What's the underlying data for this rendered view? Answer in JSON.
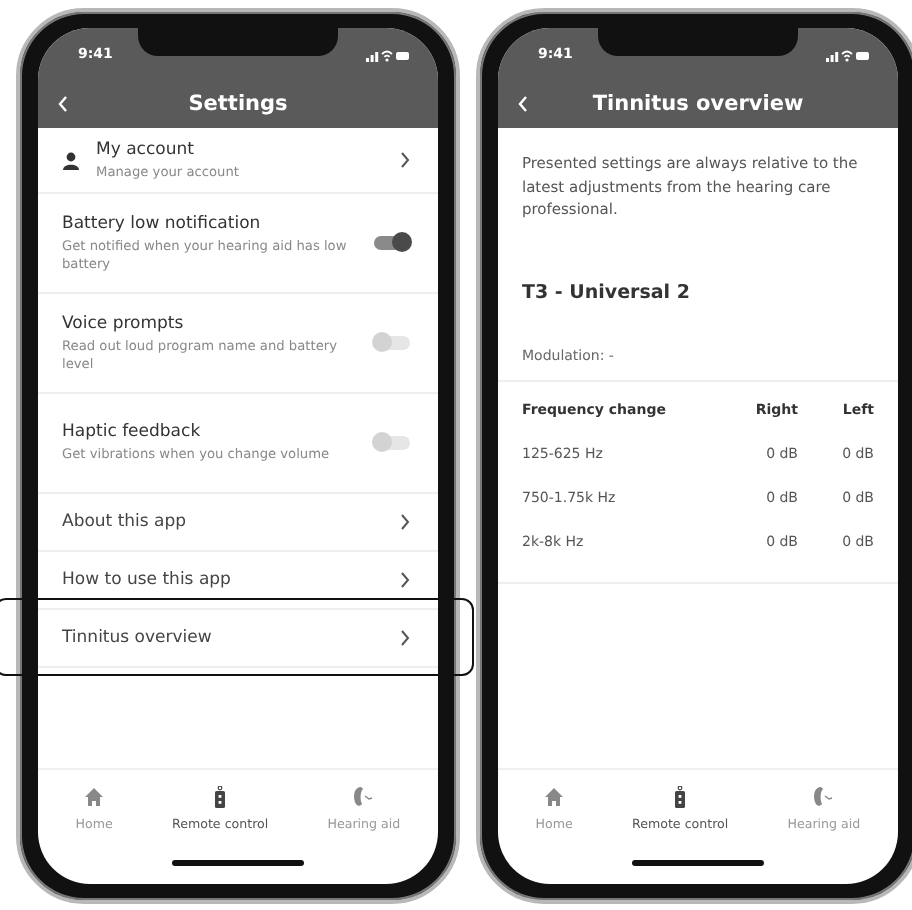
{
  "settings_screen": {
    "status_time": "9:41",
    "title": "Settings",
    "rows": [
      {
        "kind": "account",
        "title": "My account",
        "subtitle": "Manage your account",
        "highlighted": false
      },
      {
        "kind": "toggle",
        "title": "Battery low notification",
        "subtitle": "Get notified when your hearing aid has low battery",
        "on": true,
        "highlighted": false
      },
      {
        "kind": "toggle",
        "title": "Voice prompts",
        "subtitle": "Read out loud program name and battery level",
        "on": false,
        "highlighted": false
      },
      {
        "kind": "toggle",
        "title": "Haptic feedback",
        "subtitle": "Get vibrations when you change volume",
        "on": false,
        "highlighted": false
      },
      {
        "kind": "link",
        "title": "About this app",
        "highlighted": false
      },
      {
        "kind": "link",
        "title": "How to use this app",
        "highlighted": false
      },
      {
        "kind": "link",
        "title": "Tinnitus overview",
        "highlighted": true
      }
    ],
    "tab_bar": [
      {
        "label": "Home",
        "selected": false
      },
      {
        "label": "Remote control",
        "selected": true
      },
      {
        "label": "Hearing aid",
        "selected": false
      }
    ]
  },
  "tinnitus_screen": {
    "status_time": "9:41",
    "title": "Tinnitus overview",
    "intro": "Presented settings are always relative to the latest adjustments from the hearing care professional.",
    "program": "T3 - Universal 2",
    "modulation": "Modulation: -",
    "table": {
      "columns": [
        "Frequency change",
        "Right",
        "Left"
      ],
      "rows": [
        [
          "125-625 Hz",
          "0 dB",
          "0 dB"
        ],
        [
          "750-1.75k Hz",
          "0 dB",
          "0 dB"
        ],
        [
          "2k-8k Hz",
          "0 dB",
          "0 dB"
        ]
      ]
    },
    "tab_bar": [
      {
        "label": "Home",
        "selected": false
      },
      {
        "label": "Remote control",
        "selected": true
      },
      {
        "label": "Hearing aid",
        "selected": false
      }
    ]
  }
}
